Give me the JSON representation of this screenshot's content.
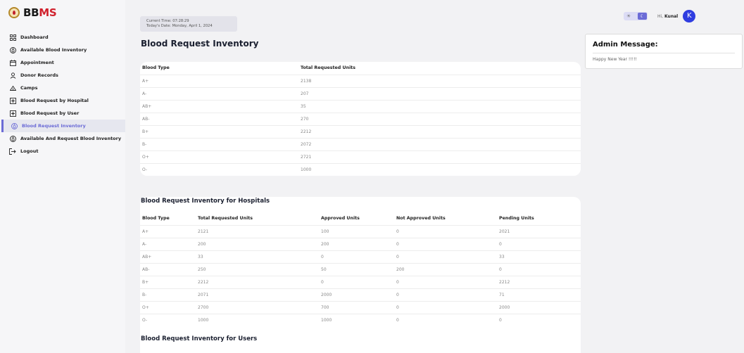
{
  "app": {
    "logo_prefix": "BB",
    "logo_suffix": "MS"
  },
  "sidebar": {
    "items": [
      {
        "label": "Dashboard",
        "icon": "grid-icon"
      },
      {
        "label": "Available Blood Inventory",
        "icon": "droplet-icon"
      },
      {
        "label": "Appointment",
        "icon": "calendar-icon"
      },
      {
        "label": "Donor Records",
        "icon": "user-icon"
      },
      {
        "label": "Camps",
        "icon": "camp-icon"
      },
      {
        "label": "Blood Request by Hospital",
        "icon": "plus-box-icon"
      },
      {
        "label": "Blood Request by User",
        "icon": "plus-box-icon"
      },
      {
        "label": "Blood Request Inventory",
        "icon": "droplet-icon",
        "active": true
      },
      {
        "label": "Available And Request Blood Inventory",
        "icon": "droplet-icon"
      },
      {
        "label": "Logout",
        "icon": "logout-icon"
      }
    ]
  },
  "header": {
    "current_time": "Current Time: 07:28:29",
    "today_date": "Today's Date: Monday, April 1, 2024",
    "greeting_prefix": "Hi,",
    "user_name": "Kunal",
    "avatar_letter": "K"
  },
  "admin": {
    "title": "Admin Message:",
    "message": "Happy New Year !!!!!"
  },
  "main": {
    "title": "Blood Request Inventory",
    "table": {
      "headers": [
        "Blood Type",
        "Total Requested Units"
      ],
      "rows": [
        [
          "A+",
          "2138"
        ],
        [
          "A-",
          "207"
        ],
        [
          "AB+",
          "35"
        ],
        [
          "AB-",
          "270"
        ],
        [
          "B+",
          "2212"
        ],
        [
          "B-",
          "2072"
        ],
        [
          "O+",
          "2721"
        ],
        [
          "O-",
          "1000"
        ]
      ]
    }
  },
  "hospitals": {
    "title": "Blood Request Inventory for Hospitals",
    "table": {
      "headers": [
        "Blood Type",
        "Total Requested Units",
        "Approved Units",
        "Not Approved Units",
        "Pending Units"
      ],
      "rows": [
        [
          "A+",
          "2121",
          "100",
          "0",
          "2021"
        ],
        [
          "A-",
          "200",
          "200",
          "0",
          "0"
        ],
        [
          "AB+",
          "33",
          "0",
          "0",
          "33"
        ],
        [
          "AB-",
          "250",
          "50",
          "200",
          "0"
        ],
        [
          "B+",
          "2212",
          "0",
          "0",
          "2212"
        ],
        [
          "B-",
          "2071",
          "2000",
          "0",
          "71"
        ],
        [
          "O+",
          "2700",
          "700",
          "0",
          "2000"
        ],
        [
          "O-",
          "1000",
          "1000",
          "0",
          "0"
        ]
      ]
    }
  },
  "users": {
    "title": "Blood Request Inventory for Users"
  }
}
